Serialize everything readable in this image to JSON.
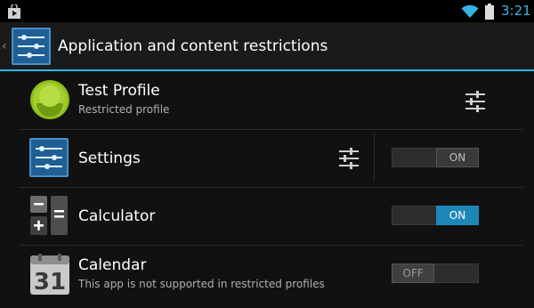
{
  "status_bar": {
    "time": "3:21",
    "icons": [
      "play-store-icon",
      "wifi-icon",
      "battery-icon"
    ]
  },
  "action_bar": {
    "title": "Application and content restrictions",
    "icon": "restrictions-sliders-icon",
    "up": "‹"
  },
  "profile": {
    "name": "Test Profile",
    "subtitle": "Restricted profile",
    "avatar": "android-avatar-icon",
    "settings_icon": "sliders-icon"
  },
  "apps": [
    {
      "name": "Settings",
      "subtitle": "",
      "icon": "settings-app-icon",
      "has_settings": true,
      "toggle": "ON",
      "enabled": true,
      "accent": false
    },
    {
      "name": "Calculator",
      "subtitle": "",
      "icon": "calculator-app-icon",
      "has_settings": false,
      "toggle": "ON",
      "enabled": true,
      "accent": true
    },
    {
      "name": "Calendar",
      "subtitle": "This app is not supported in restricted profiles",
      "icon": "calendar-app-icon",
      "has_settings": false,
      "toggle": "OFF",
      "enabled": false,
      "accent": false
    }
  ],
  "calendar_icon_day": "31",
  "colors": {
    "accent": "#33b5e5",
    "toggle_on": "#1d87b7",
    "background": "#111111"
  }
}
